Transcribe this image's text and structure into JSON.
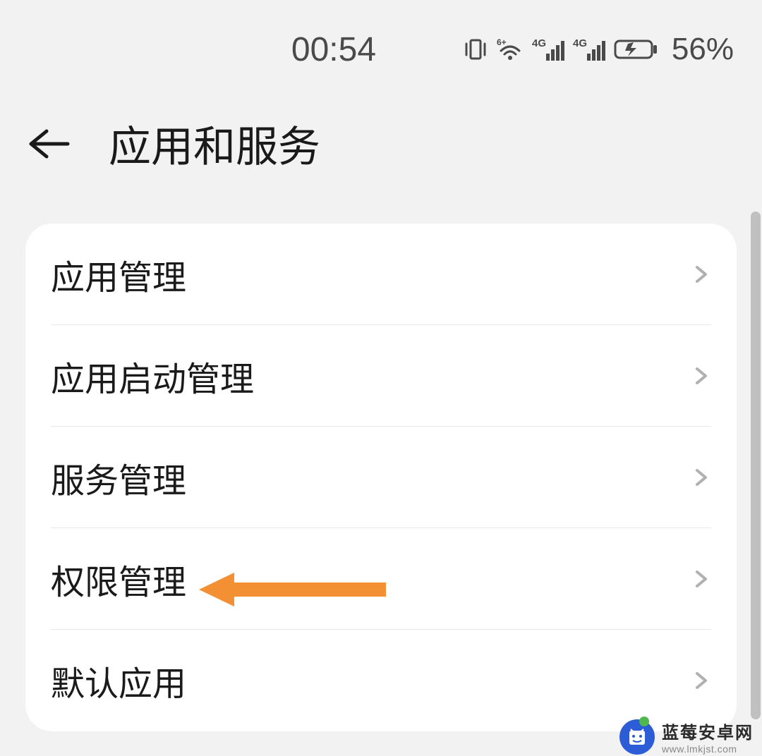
{
  "status_bar": {
    "time": "00:54",
    "battery_percent": "56%"
  },
  "header": {
    "title": "应用和服务"
  },
  "menu": {
    "items": [
      {
        "label": "应用管理"
      },
      {
        "label": "应用启动管理"
      },
      {
        "label": "服务管理"
      },
      {
        "label": "权限管理"
      },
      {
        "label": "默认应用"
      }
    ]
  },
  "annotation": {
    "highlight_index": 3,
    "arrow_color": "#f29033"
  },
  "watermark": {
    "title": "蓝莓安卓网",
    "url": "www.lmkjst.com"
  }
}
